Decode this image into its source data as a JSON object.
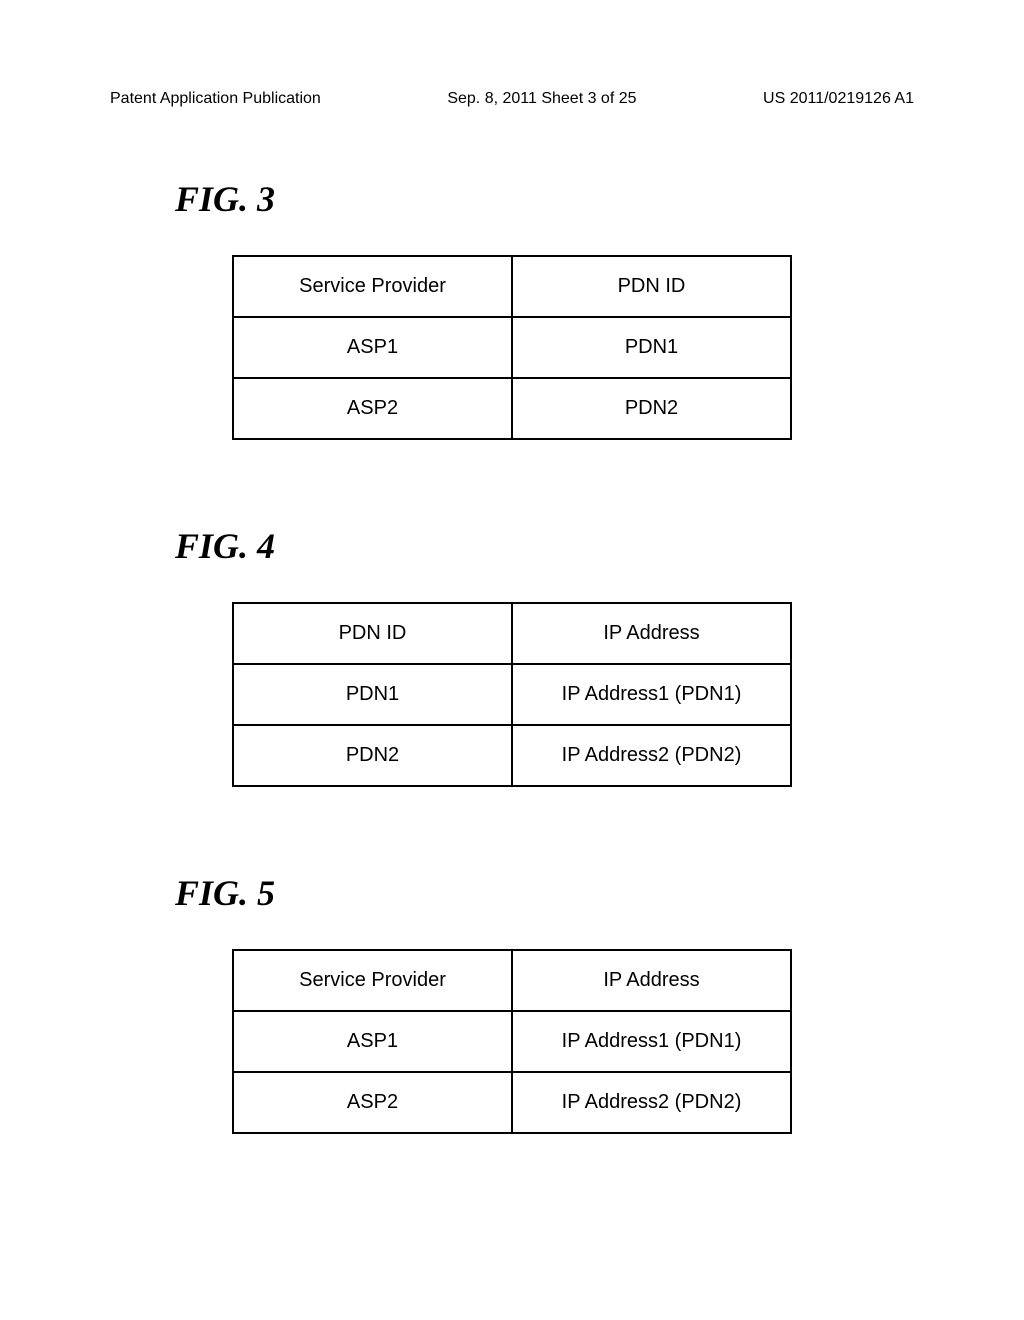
{
  "header": {
    "left": "Patent Application Publication",
    "center": "Sep. 8, 2011  Sheet 3 of 25",
    "right": "US 2011/0219126 A1"
  },
  "figures": [
    {
      "label": "FIG. 3",
      "headers": [
        "Service Provider",
        "PDN ID"
      ],
      "rows": [
        [
          "ASP1",
          "PDN1"
        ],
        [
          "ASP2",
          "PDN2"
        ]
      ]
    },
    {
      "label": "FIG. 4",
      "headers": [
        "PDN ID",
        "IP Address"
      ],
      "rows": [
        [
          "PDN1",
          "IP Address1  (PDN1)"
        ],
        [
          "PDN2",
          "IP Address2  (PDN2)"
        ]
      ]
    },
    {
      "label": "FIG. 5",
      "headers": [
        "Service Provider",
        "IP Address"
      ],
      "rows": [
        [
          "ASP1",
          "IP Address1  (PDN1)"
        ],
        [
          "ASP2",
          "IP Address2  (PDN2)"
        ]
      ]
    }
  ]
}
